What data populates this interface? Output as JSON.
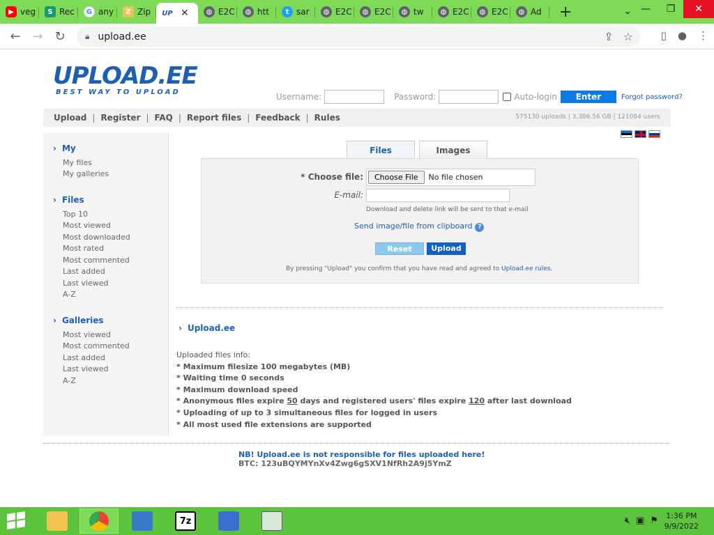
{
  "browser": {
    "tabs": [
      {
        "label": "veg",
        "icon": "youtube-icon"
      },
      {
        "label": "Rec",
        "icon": "s-icon"
      },
      {
        "label": "any",
        "icon": "google-icon"
      },
      {
        "label": "Zip",
        "icon": "zip-icon"
      },
      {
        "label": "",
        "icon": "upload-ee-icon",
        "active": true
      },
      {
        "label": "E2C",
        "icon": "globe-icon"
      },
      {
        "label": "htt",
        "icon": "globe-icon"
      },
      {
        "label": "sar",
        "icon": "twitter-icon"
      },
      {
        "label": "E2C",
        "icon": "globe-icon"
      },
      {
        "label": "E2C",
        "icon": "globe-icon"
      },
      {
        "label": "tw",
        "icon": "globe-icon"
      },
      {
        "label": "E2C",
        "icon": "globe-icon"
      },
      {
        "label": "E2C",
        "icon": "globe-icon"
      },
      {
        "label": "Ad",
        "icon": "globe-icon"
      }
    ],
    "url": "upload.ee"
  },
  "logo": {
    "main": "UPLOAD.EE",
    "tagline": "BEST WAY TO UPLOAD"
  },
  "login": {
    "username_label": "Username:",
    "password_label": "Password:",
    "autologin_label": "Auto-login",
    "enter_label": "Enter",
    "forgot_label": "Forgot password?"
  },
  "menu": {
    "items": [
      "Upload",
      "Register",
      "FAQ",
      "Report files",
      "Feedback",
      "Rules"
    ],
    "stats": "575130 uploads  |  3,386.56 GB  |  121084 users"
  },
  "sidebar": {
    "my": {
      "title": "My",
      "items": [
        "My files",
        "My galleries"
      ]
    },
    "files": {
      "title": "Files",
      "items": [
        "Top 10",
        "Most viewed",
        "Most downloaded",
        "Most rated",
        "Most commented",
        "Last added",
        "Last viewed",
        "A-Z"
      ]
    },
    "galleries": {
      "title": "Galleries",
      "items": [
        "Most viewed",
        "Most commented",
        "Last added",
        "Last viewed",
        "A-Z"
      ]
    }
  },
  "upload_form": {
    "tabs": [
      "Files",
      "Images"
    ],
    "choose_file_label": "* Choose file:",
    "choose_button": "Choose File",
    "no_file": "No file chosen",
    "email_label": "E-mail:",
    "email_hint": "Download and delete link will be sent to that e-mail",
    "clipboard_link": "Send image/file from clipboard",
    "reset_label": "Reset",
    "upload_label": "Upload",
    "agree_prefix": "By pressing \"Upload\" you confirm that you have read and agreed to ",
    "agree_link": "Upload.ee rules."
  },
  "info": {
    "section_link": "Upload.ee",
    "heading": "Uploaded files info:",
    "line1": "* Maximum filesize 100 megabytes (MB)",
    "line2": "* Waiting time 0 seconds",
    "line3": "* Maximum download speed",
    "line4_a": "* Anonymous files expire ",
    "line4_n1": "50",
    "line4_b": " days and registered users' files expire ",
    "line4_n2": "120",
    "line4_c": " after last download",
    "line5": "* Uploading of up to 3 simultaneous files for logged in users",
    "line6": "* All most used file extensions are supported"
  },
  "footer": {
    "nb": "NB! Upload.ee is not responsible for files uploaded here!",
    "btc": "BTC: 123uBQYMYnXv4Zwg6gSXV1NfRh2A9j5YmZ"
  },
  "taskbar": {
    "time": "1:36 PM",
    "date": "9/9/2022"
  }
}
